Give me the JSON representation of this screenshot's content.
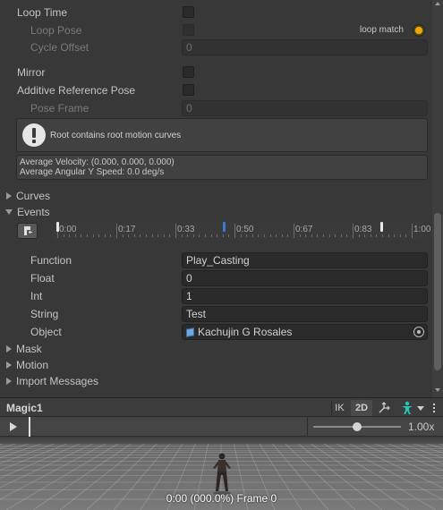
{
  "loop_time": {
    "label": "Loop Time"
  },
  "loop_pose": {
    "label": "Loop Pose",
    "match_label": "loop match"
  },
  "cycle_offset": {
    "label": "Cycle Offset",
    "value": "0"
  },
  "mirror": {
    "label": "Mirror"
  },
  "additive": {
    "label": "Additive Reference Pose"
  },
  "pose_frame": {
    "label": "Pose Frame",
    "value": "0"
  },
  "help_box": {
    "text": "Root contains root motion curves"
  },
  "info_box": {
    "velocity": "Average Velocity: (0.000, 0.000, 0.000)",
    "angular": "Average Angular Y Speed: 0.0 deg/s"
  },
  "sections": {
    "curves": "Curves",
    "events": "Events",
    "mask": "Mask",
    "motion": "Motion",
    "import_messages": "Import Messages"
  },
  "timeline": {
    "labels": [
      "0:00",
      "0:17",
      "0:33",
      "0:50",
      "0:67",
      "0:83",
      "1:00"
    ],
    "event_markers": [
      0.0,
      0.47,
      0.915
    ],
    "selected_marker": 1
  },
  "event": {
    "function_label": "Function",
    "function_value": "Play_Casting",
    "float_label": "Float",
    "float_value": "0",
    "int_label": "Int",
    "int_value": "1",
    "string_label": "String",
    "string_value": "Test",
    "object_label": "Object",
    "object_value": "Kachujin G Rosales"
  },
  "preview": {
    "title": "Magic1",
    "ik_label": "IK",
    "mode_2d_label": "2D",
    "speed": "1.00x",
    "speed_fraction": 0.5,
    "status": "0:00 (000.0%) Frame 0"
  },
  "colors": {
    "accent_blue": "#3a79d8",
    "loop_match_orange": "#f0a800",
    "avatar_teal": "#26c6b7"
  }
}
